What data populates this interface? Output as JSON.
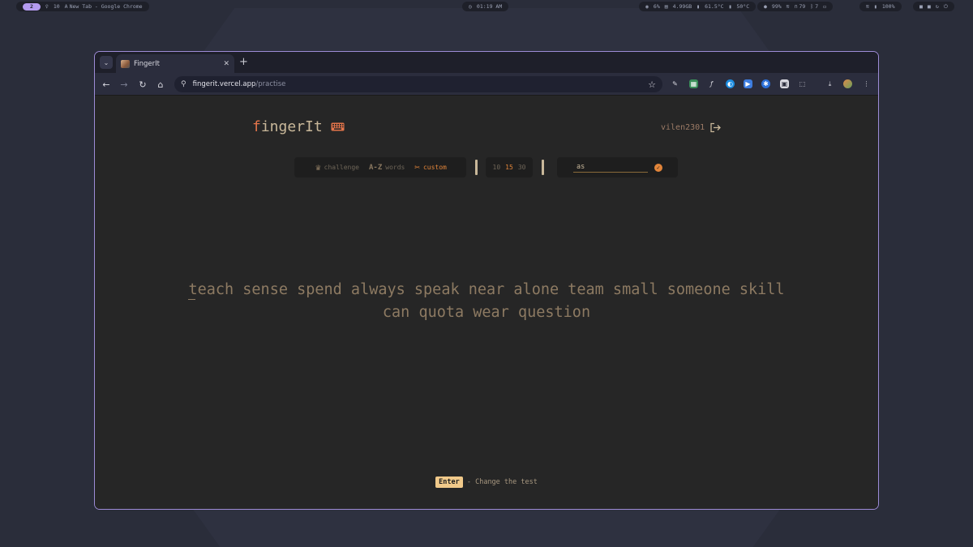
{
  "system_bar": {
    "workspace_active": "2",
    "workspace_other_icon": "♀",
    "workspace_other": "10",
    "active_window_icon": "A",
    "active_window": "New Tab - Google Chrome",
    "clock": "01:19 AM",
    "cpu": "6%",
    "memory": "4.99GB",
    "temp1": "61.5°C",
    "temp2": "50°C",
    "brightness": "99%",
    "headset": "79",
    "bluetooth_count": "7",
    "battery": "100%"
  },
  "browser": {
    "tab_title": "FingerIt",
    "url_host": "fingerit.vercel.app",
    "url_path": "/practise",
    "extension_icons": [
      "pen-icon",
      "grid-icon",
      "fx-icon",
      "blue-circle-icon",
      "video-icon",
      "gear-icon",
      "photo-icon",
      "puzzle-icon"
    ]
  },
  "app": {
    "logo_first": "f",
    "logo_rest": "ingerIt",
    "username": "vilen2301",
    "modes": [
      {
        "label": "challenge",
        "icon": "crown-icon"
      },
      {
        "label": "words",
        "icon": "az-icon",
        "icon_text": "A-Z"
      },
      {
        "label": "custom",
        "icon": "tools-icon"
      }
    ],
    "active_mode": "custom",
    "durations": [
      "10",
      "15",
      "30"
    ],
    "active_duration": "15",
    "custom_input_value": "as",
    "words_line1_first": "teach",
    "words_line1_rest": " sense spend always speak near alone team small someone skill",
    "words_line2": "can quota wear question",
    "hint_key": "Enter",
    "hint_text": " - Change the test",
    "colors": {
      "accent": "#e2853a",
      "logo_accent": "#e2744a",
      "text": "#8d7a62"
    }
  }
}
